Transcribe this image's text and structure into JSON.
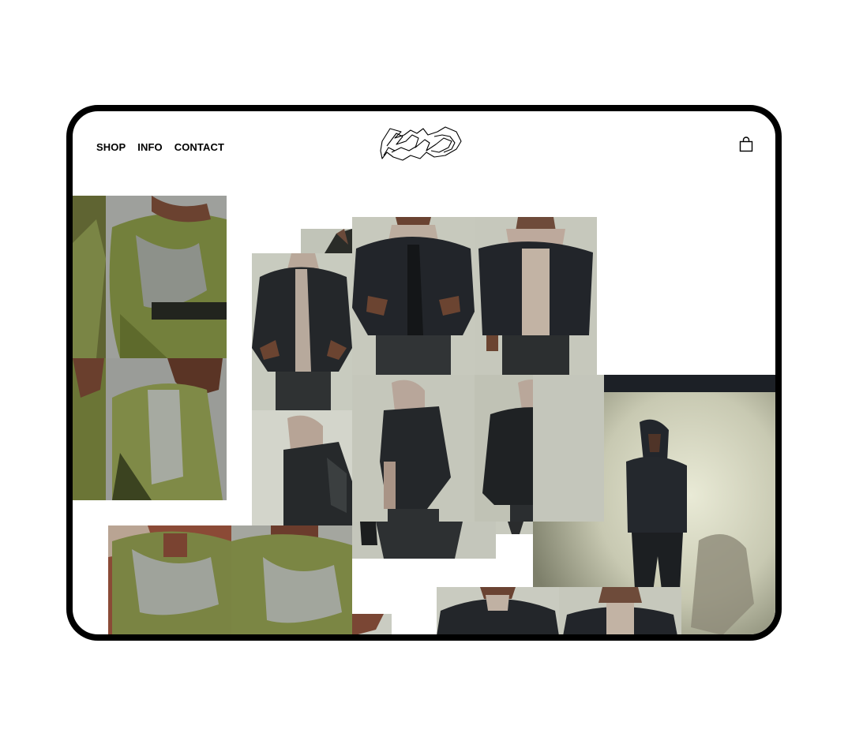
{
  "nav": {
    "items": [
      {
        "label": "SHOP"
      },
      {
        "label": "INFO"
      },
      {
        "label": "CONTACT"
      }
    ]
  },
  "brand": {
    "logo_icon": "graffiti-logo-icon",
    "cart_icon": "shopping-bag-icon"
  },
  "colors": {
    "frame": "#000000",
    "background": "#ffffff",
    "olive_jersey": "#6f7a3c",
    "grey_panel": "#8f928c",
    "black_jacket": "#1f2220",
    "studio_wall": "#c9ccbf",
    "hood_beige": "#b8a79b"
  }
}
